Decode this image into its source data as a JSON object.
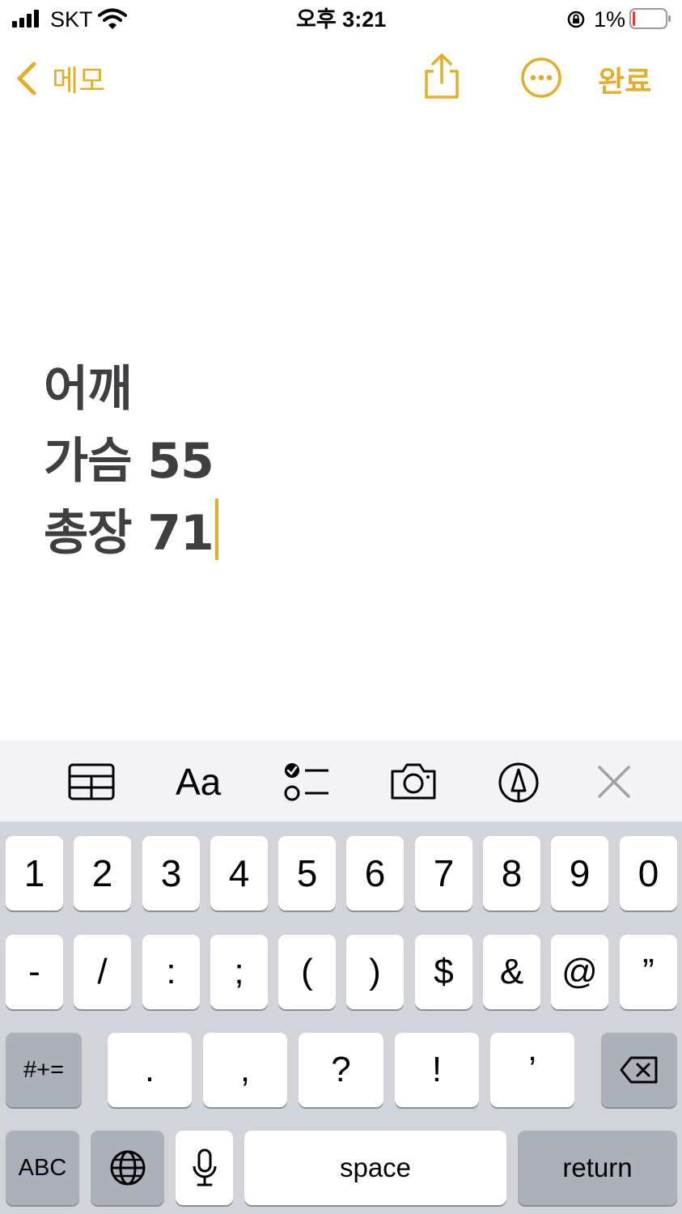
{
  "status_bar": {
    "carrier": "SKT",
    "time": "오후 3:21",
    "battery_percent": "1%",
    "battery_level": 0.01
  },
  "nav": {
    "back_label": "메모",
    "done_label": "완료",
    "accent_color": "#E3AE2C"
  },
  "note": {
    "lines": [
      "어깨",
      "가슴 55",
      "총장 71"
    ]
  },
  "toolbar": {
    "format_label": "Aa",
    "icons": [
      "table-icon",
      "format-icon",
      "checklist-icon",
      "camera-icon",
      "markup-icon",
      "close-icon"
    ]
  },
  "keyboard": {
    "row1": [
      "1",
      "2",
      "3",
      "4",
      "5",
      "6",
      "7",
      "8",
      "9",
      "0"
    ],
    "row2": [
      "-",
      "/",
      ":",
      ";",
      "(",
      ")",
      "$",
      "&",
      "@",
      "”"
    ],
    "row3": [
      ".",
      ",",
      "?",
      "!",
      "’"
    ],
    "symbols_label": "#+=",
    "abc_label": "ABC",
    "space_label": "space",
    "return_label": "return"
  }
}
